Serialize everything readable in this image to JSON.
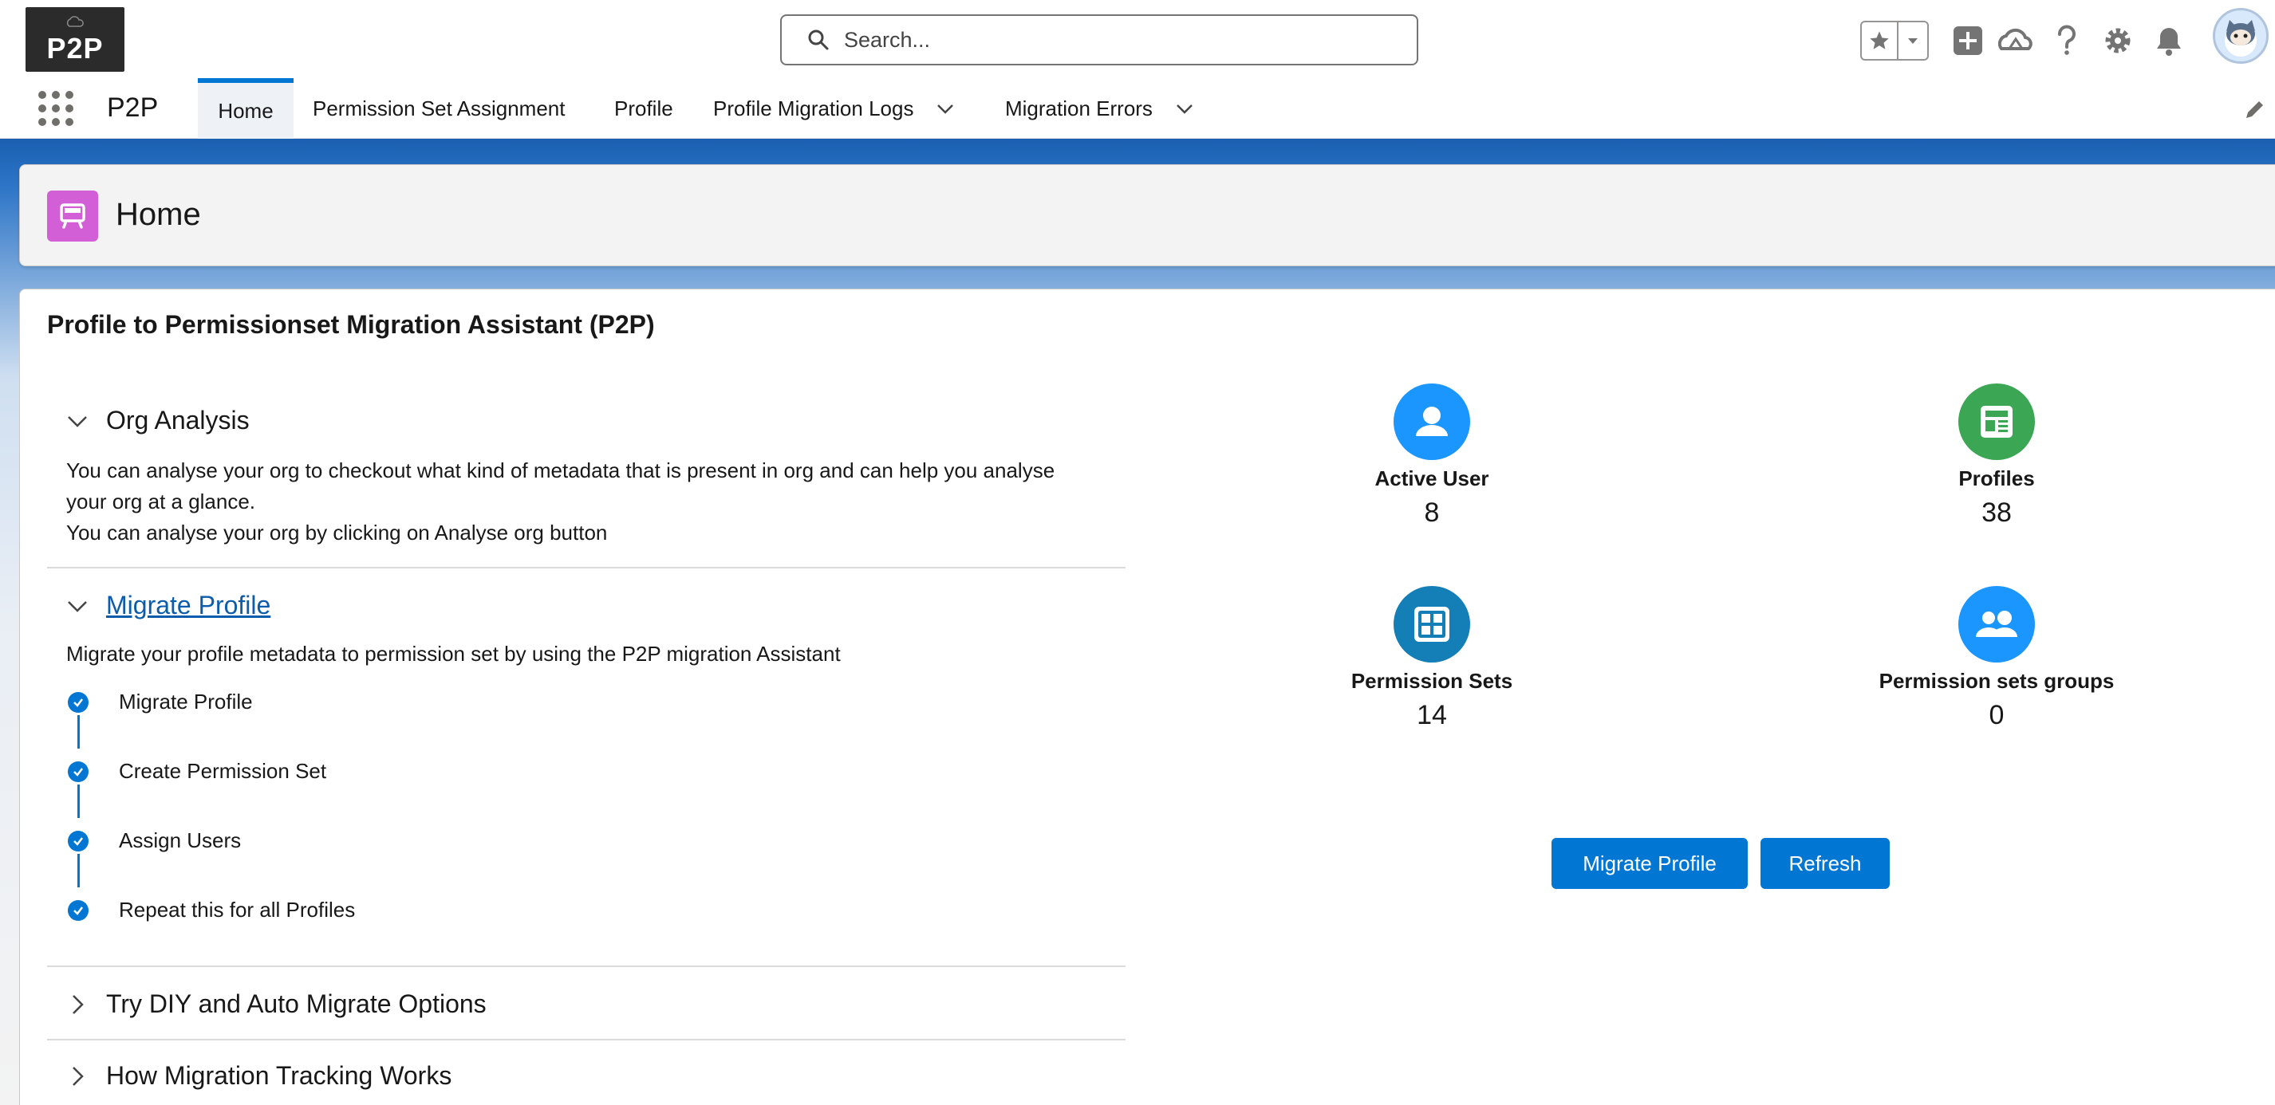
{
  "header": {
    "logo_text": "P2P",
    "search_placeholder": "Search..."
  },
  "nav": {
    "app_name": "P2P",
    "tabs": [
      {
        "label": "Home",
        "active": true
      },
      {
        "label": "Permission Set Assignment"
      },
      {
        "label": "Profile"
      },
      {
        "label": "Profile Migration Logs",
        "has_menu": true
      },
      {
        "label": "Migration Errors",
        "has_menu": true
      }
    ]
  },
  "page": {
    "title": "Home",
    "icon": "home-tile-icon",
    "icon_color": "#d35fd6"
  },
  "card": {
    "title": "Profile to Permissionset Migration Assistant (P2P)",
    "sections": {
      "org_analysis": {
        "title": "Org Analysis",
        "line1": "You can analyse your org to checkout what kind of metadata that is present in org and can help you analyse",
        "line2": "your org at a glance.",
        "line3": "You can analyse your org by clicking on Analyse org button"
      },
      "migrate_profile": {
        "title": "Migrate Profile",
        "description": "Migrate your profile metadata to permission set by using the P2P migration Assistant",
        "steps": [
          "Migrate Profile",
          "Create Permission Set",
          "Assign Users",
          "Repeat this for all Profiles"
        ]
      },
      "diy": {
        "title": "Try DIY and Auto Migrate Options"
      },
      "tracking": {
        "title": "How Migration Tracking Works"
      }
    },
    "stats": [
      {
        "label": "Active User",
        "value": "8",
        "icon": "user-icon",
        "color": "#1b96ff"
      },
      {
        "label": "Profiles",
        "value": "38",
        "icon": "profile-icon",
        "color": "#3ba755"
      },
      {
        "label": "Permission Sets",
        "value": "14",
        "icon": "permission-set-icon",
        "color": "#137fb6"
      },
      {
        "label": "Permission sets groups",
        "value": "0",
        "icon": "group-icon",
        "color": "#1b96ff"
      }
    ],
    "buttons": {
      "migrate": "Migrate Profile",
      "refresh": "Refresh"
    }
  },
  "colors": {
    "brand": "#0176d3"
  }
}
